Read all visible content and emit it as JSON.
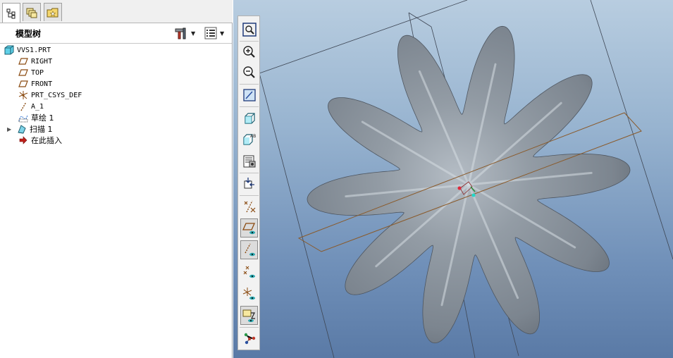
{
  "left_panel": {
    "tabs": [
      "model-tree-tab",
      "layers-tab",
      "favorites-tab"
    ],
    "header": {
      "title": "模型树"
    },
    "tree": [
      {
        "label": "VVS1.PRT",
        "icon": "part-icon"
      },
      {
        "label": "RIGHT",
        "icon": "datum-plane-icon"
      },
      {
        "label": "TOP",
        "icon": "datum-plane-icon"
      },
      {
        "label": "FRONT",
        "icon": "datum-plane-icon"
      },
      {
        "label": "PRT_CSYS_DEF",
        "icon": "coordinate-system-icon"
      },
      {
        "label": "A_1",
        "icon": "datum-axis-icon"
      },
      {
        "label": "草绘 1",
        "icon": "sketch-icon"
      },
      {
        "label": "扫描 1",
        "icon": "sweep-icon"
      },
      {
        "label": "在此插入",
        "icon": "insert-here-icon"
      }
    ]
  },
  "toolbar": {
    "buttons": [
      "refit-icon",
      "zoom-in-icon",
      "zoom-out-icon",
      "repaint-icon",
      "orientation-icon",
      "saved-views-icon",
      "view-manager-icon",
      "spin-center-icon",
      "datum-display-filters-icon",
      "plane-display-icon",
      "axis-display-icon",
      "point-display-icon",
      "csys-display-icon",
      "annotation-display-icon",
      "network-display-icon"
    ]
  },
  "colors": {
    "viewport_top": "#b8cde0",
    "viewport_bottom": "#5a7aa6",
    "model_shade": "#8c959d",
    "datum_plane": "#8a5a2a",
    "datum_frame": "#3e4654"
  }
}
